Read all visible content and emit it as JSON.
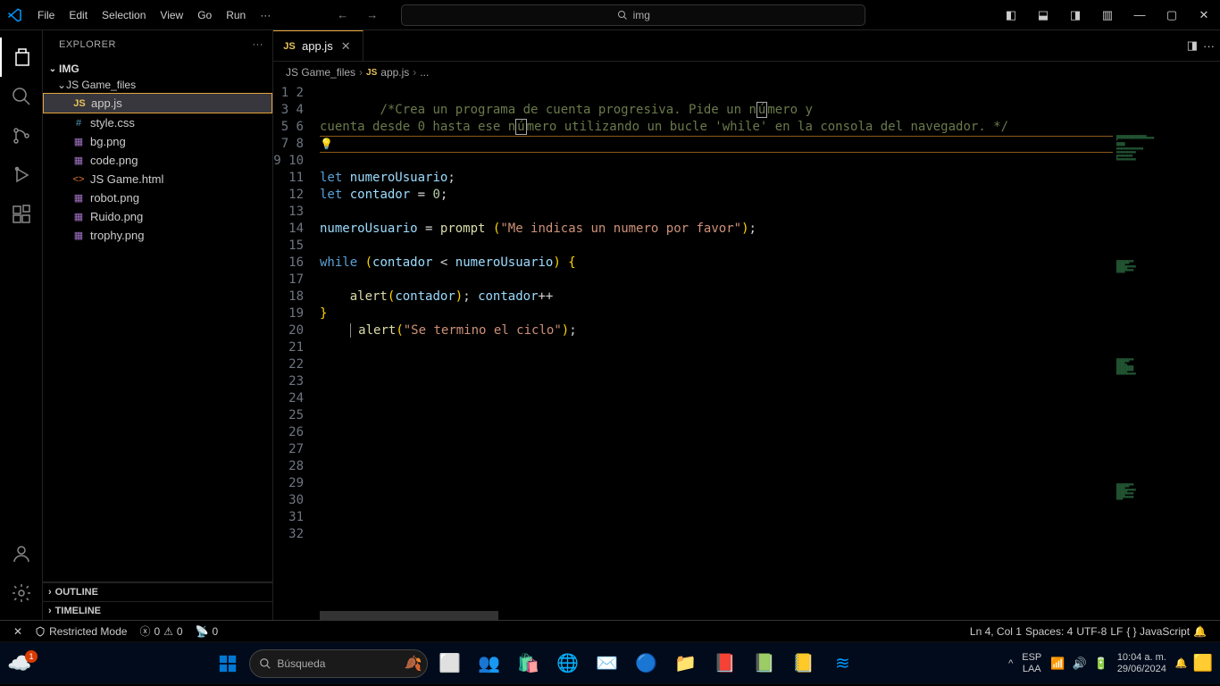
{
  "menubar": [
    "File",
    "Edit",
    "Selection",
    "View",
    "Go",
    "Run",
    "···"
  ],
  "search_placeholder": "img",
  "explorer": {
    "title": "EXPLORER",
    "root": "IMG",
    "subfolder": "JS Game_files",
    "files": [
      {
        "name": "app.js",
        "icon": "js",
        "active": true
      },
      {
        "name": "style.css",
        "icon": "css"
      },
      {
        "name": "bg.png",
        "icon": "img"
      },
      {
        "name": "code.png",
        "icon": "img"
      },
      {
        "name": "JS Game.html",
        "icon": "html"
      },
      {
        "name": "robot.png",
        "icon": "img"
      },
      {
        "name": "Ruido.png",
        "icon": "img"
      },
      {
        "name": "trophy.png",
        "icon": "img"
      }
    ],
    "outline": "OUTLINE",
    "timeline": "TIMELINE"
  },
  "tab": {
    "name": "app.js"
  },
  "breadcrumb": [
    "JS Game_files",
    "app.js",
    "..."
  ],
  "code_lines": 32,
  "status": {
    "restricted": "Restricted Mode",
    "errors": "0",
    "warnings": "0",
    "ports": "0",
    "lncol": "Ln 4, Col 1",
    "spaces": "Spaces: 4",
    "encoding": "UTF-8",
    "eol": "LF",
    "lang": "JavaScript"
  },
  "taskbar": {
    "search": "Búsqueda",
    "lang1": "ESP",
    "lang2": "LAA",
    "time": "10:04 a. m.",
    "date": "29/06/2024",
    "badge": "1"
  }
}
